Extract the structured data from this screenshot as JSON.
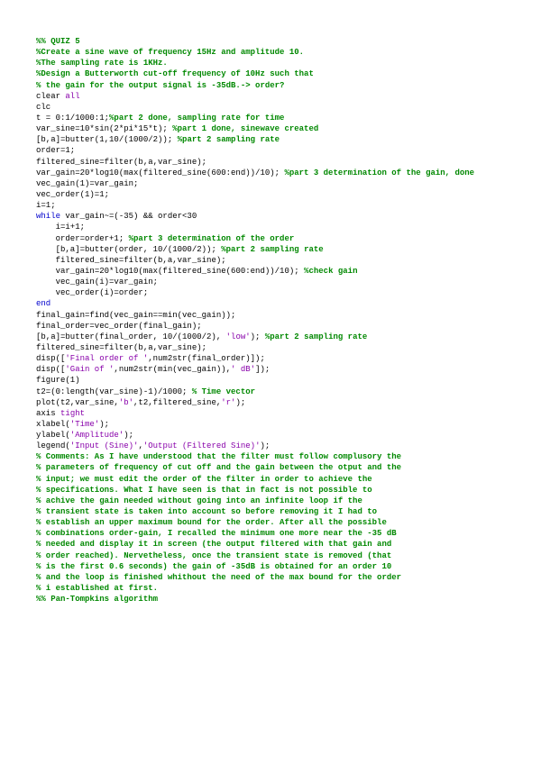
{
  "lines": [
    [
      [
        "cm",
        "%% QUIZ 5"
      ]
    ],
    [
      [
        "cm",
        "%Create a sine wave of frequency 15Hz and amplitude 10."
      ]
    ],
    [
      [
        "cm",
        "%The sampling rate is 1KHz."
      ]
    ],
    [
      [
        "cm",
        "%Design a Butterworth cut-off frequency of 10Hz such that"
      ]
    ],
    [
      [
        "cm",
        "% the gain for the output signal is -35dB.-> order?"
      ]
    ],
    [
      [
        "tx",
        "clear "
      ],
      [
        "st",
        "all"
      ]
    ],
    [
      [
        "tx",
        "clc"
      ]
    ],
    [
      [
        "tx",
        "t = 0:1/1000:1;"
      ],
      [
        "cm",
        "%part 2 done, sampling rate for time"
      ]
    ],
    [
      [
        "tx",
        "var_sine=10*sin(2*pi*15*t); "
      ],
      [
        "cm",
        "%part 1 done, sinewave created"
      ]
    ],
    [
      [
        "tx",
        "[b,a]=butter(1,10/(1000/2)); "
      ],
      [
        "cm",
        "%part 2 sampling rate"
      ]
    ],
    [
      [
        "tx",
        "order=1;"
      ]
    ],
    [
      [
        "tx",
        "filtered_sine=filter(b,a,var_sine);"
      ]
    ],
    [
      [
        "tx",
        "var_gain=20*log10(max(filtered_sine(600:end))/10); "
      ],
      [
        "cm",
        "%part 3 determination of the gain, done"
      ]
    ],
    [
      [
        "tx",
        "vec_gain(1)=var_gain;"
      ]
    ],
    [
      [
        "tx",
        "vec_order(1)=1;"
      ]
    ],
    [
      [
        "tx",
        "i=1;"
      ]
    ],
    [
      [
        "kw",
        "while "
      ],
      [
        "tx",
        "var_gain~=(-35) && order<30"
      ]
    ],
    [
      [
        "tx",
        "    i=i+1;"
      ]
    ],
    [
      [
        "tx",
        "    order=order+1; "
      ],
      [
        "cm",
        "%part 3 determination of the order"
      ]
    ],
    [
      [
        "tx",
        "    [b,a]=butter(order, 10/(1000/2)); "
      ],
      [
        "cm",
        "%part 2 sampling rate"
      ]
    ],
    [
      [
        "tx",
        "    filtered_sine=filter(b,a,var_sine);"
      ]
    ],
    [
      [
        "tx",
        "    var_gain=20*log10(max(filtered_sine(600:end))/10); "
      ],
      [
        "cm",
        "%check gain"
      ]
    ],
    [
      [
        "tx",
        "    vec_gain(i)=var_gain;"
      ]
    ],
    [
      [
        "tx",
        "    vec_order(i)=order;"
      ]
    ],
    [
      [
        "kw",
        "end"
      ]
    ],
    [
      [
        "tx",
        "final_gain=find(vec_gain==min(vec_gain));"
      ]
    ],
    [
      [
        "tx",
        "final_order=vec_order(final_gain);"
      ]
    ],
    [
      [
        "tx",
        "[b,a]=butter(final_order, 10/(1000/2), "
      ],
      [
        "st",
        "'low'"
      ],
      [
        "tx",
        "); "
      ],
      [
        "cm",
        "%part 2 sampling rate"
      ]
    ],
    [
      [
        "tx",
        "filtered_sine=filter(b,a,var_sine);"
      ]
    ],
    [
      [
        "tx",
        "disp(["
      ],
      [
        "st",
        "'Final order of '"
      ],
      [
        "tx",
        ",num2str(final_order)]);"
      ]
    ],
    [
      [
        "tx",
        "disp(["
      ],
      [
        "st",
        "'Gain of '"
      ],
      [
        "tx",
        ",num2str(min(vec_gain)),"
      ],
      [
        "st",
        "' dB'"
      ],
      [
        "tx",
        "]);"
      ]
    ],
    [
      [
        "tx",
        "figure(1)"
      ]
    ],
    [
      [
        "tx",
        "t2=(0:length(var_sine)-1)/1000; "
      ],
      [
        "cm",
        "% Time vector"
      ]
    ],
    [
      [
        "tx",
        "plot(t2,var_sine,"
      ],
      [
        "st",
        "'b'"
      ],
      [
        "tx",
        ",t2,filtered_sine,"
      ],
      [
        "st",
        "'r'"
      ],
      [
        "tx",
        ");"
      ]
    ],
    [
      [
        "tx",
        "axis "
      ],
      [
        "st",
        "tight"
      ]
    ],
    [
      [
        "tx",
        "xlabel("
      ],
      [
        "st",
        "'Time'"
      ],
      [
        "tx",
        ");"
      ]
    ],
    [
      [
        "tx",
        "ylabel("
      ],
      [
        "st",
        "'Amplitude'"
      ],
      [
        "tx",
        ");"
      ]
    ],
    [
      [
        "tx",
        "legend("
      ],
      [
        "st",
        "'Input (Sine)'"
      ],
      [
        "tx",
        ","
      ],
      [
        "st",
        "'Output (Filtered Sine)'"
      ],
      [
        "tx",
        ");"
      ]
    ],
    [
      [
        "cm",
        "% Comments: As I have understood that the filter must follow complusory the"
      ]
    ],
    [
      [
        "cm",
        "% parameters of frequency of cut off and the gain between the otput and the"
      ]
    ],
    [
      [
        "cm",
        "% input; we must edit the order of the filter in order to achieve the"
      ]
    ],
    [
      [
        "cm",
        "% specifications. What I have seen is that in fact is not possible to"
      ]
    ],
    [
      [
        "cm",
        "% achive the gain needed without going into an infinite loop if the"
      ]
    ],
    [
      [
        "cm",
        "% transient state is taken into account so before removing it I had to"
      ]
    ],
    [
      [
        "cm",
        "% establish an upper maximum bound for the order. After all the possible"
      ]
    ],
    [
      [
        "cm",
        "% combinations order-gain, I recalled the minimum one more near the -35 dB"
      ]
    ],
    [
      [
        "cm",
        "% needed and display it in screen (the output filtered with that gain and"
      ]
    ],
    [
      [
        "cm",
        "% order reached). Nervetheless, once the transient state is removed (that"
      ]
    ],
    [
      [
        "cm",
        "% is the first 0.6 seconds) the gain of -35dB is obtained for an order 10"
      ]
    ],
    [
      [
        "cm",
        "% and the loop is finished whithout the need of the max bound for the order"
      ]
    ],
    [
      [
        "cm",
        "% i established at first."
      ]
    ],
    [
      [
        "cm",
        "%% Pan-Tompkins algorithm"
      ]
    ]
  ]
}
